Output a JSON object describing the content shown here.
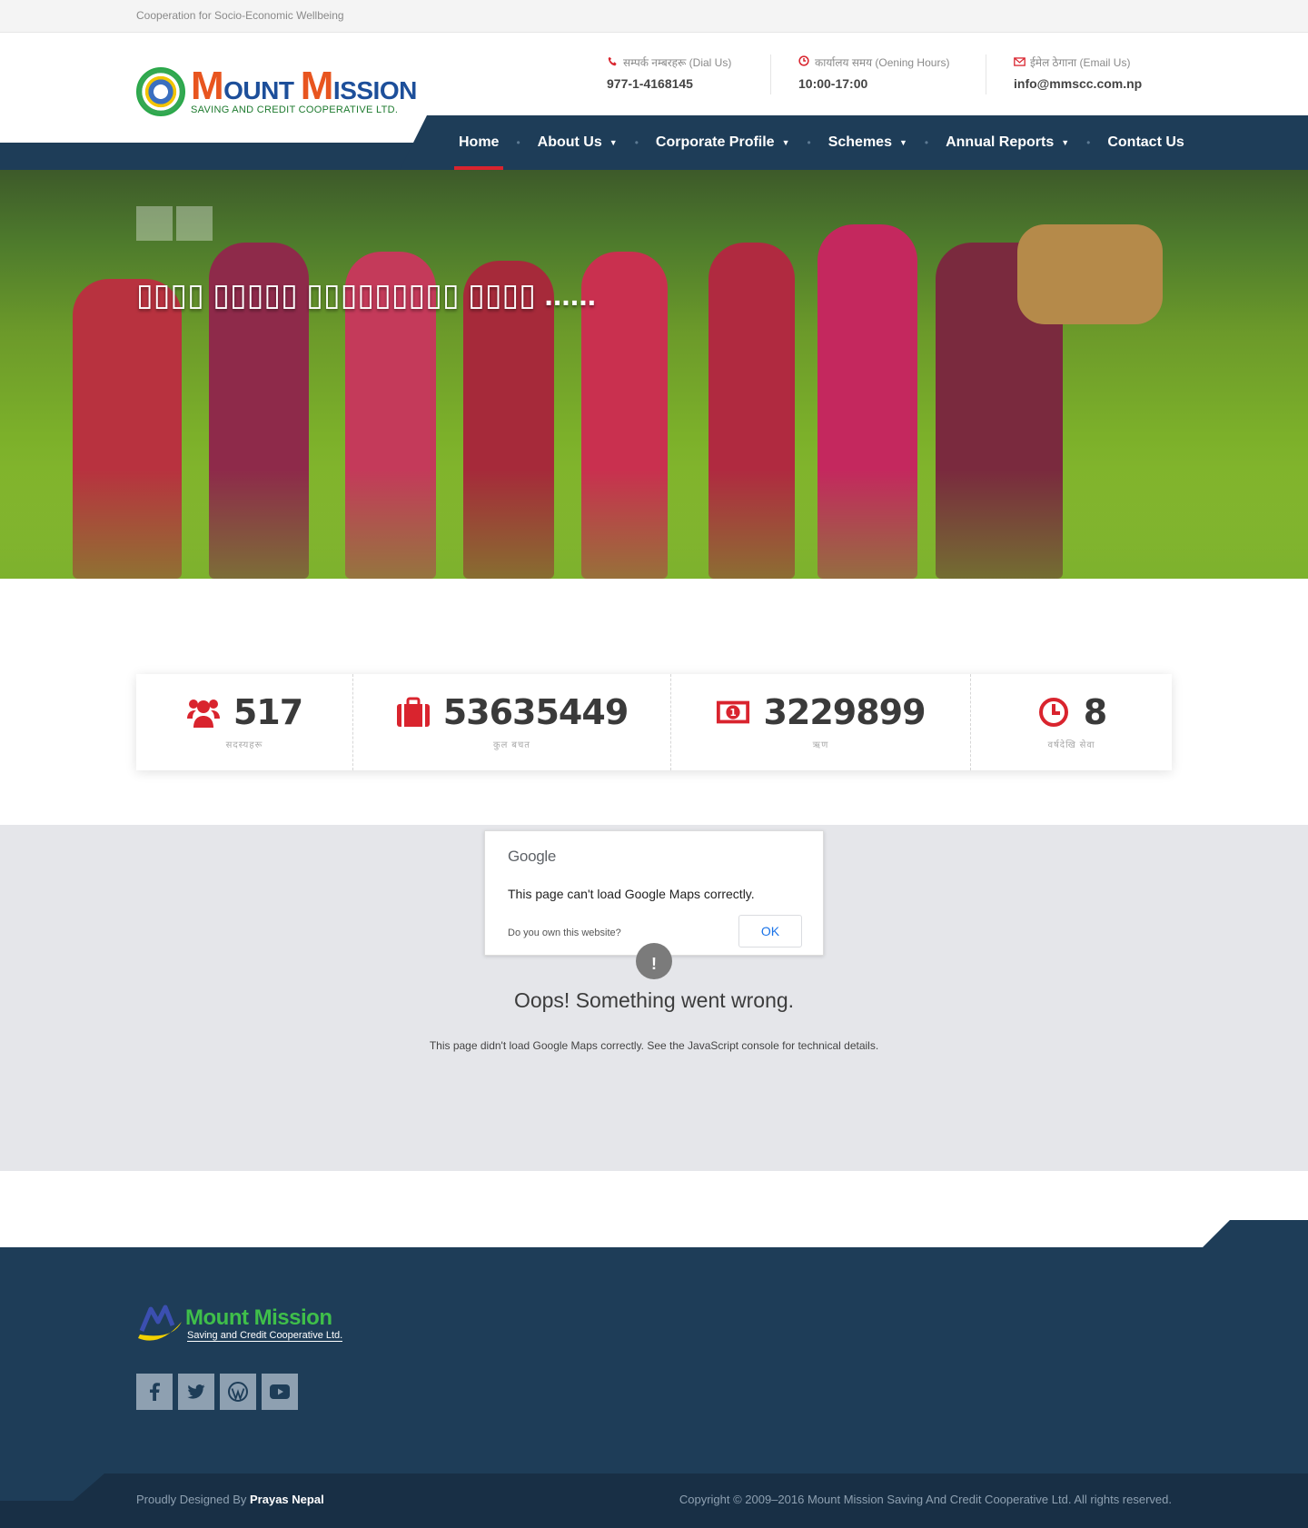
{
  "topbar": {
    "tagline": "Cooperation for Socio-Economic Wellbeing"
  },
  "logo": {
    "brand_m1": "M",
    "brand_1": "OUNT ",
    "brand_m2": "M",
    "brand_2": "ISSION",
    "subtitle": "SAVING AND CREDIT COOPERATIVE LTD."
  },
  "contacts": [
    {
      "icon": "phone-icon",
      "label": "सम्पर्क नम्बरहरू (Dial Us)",
      "value": "977-1-4168145"
    },
    {
      "icon": "clock-icon",
      "label": "कार्यालय समय (Oening Hours)",
      "value": "10:00-17:00"
    },
    {
      "icon": "envelope-icon",
      "label": "ईमेल ठेगाना (Email Us)",
      "value": "info@mmscc.com.np"
    }
  ],
  "nav": [
    {
      "label": "Home",
      "active": true,
      "dropdown": false
    },
    {
      "label": "About Us",
      "active": false,
      "dropdown": true
    },
    {
      "label": "Corporate Profile",
      "active": false,
      "dropdown": true
    },
    {
      "label": "Schemes",
      "active": false,
      "dropdown": true
    },
    {
      "label": "Annual Reports",
      "active": false,
      "dropdown": true
    },
    {
      "label": "Contact Us",
      "active": false,
      "dropdown": false
    }
  ],
  "hero": {
    "title": "▯▯▯▯ ▯▯▯▯▯ ▯▯▯▯▯▯▯▯▯ ▯▯▯▯ ......"
  },
  "stats": [
    {
      "icon": "users-icon",
      "value": "517",
      "label": "सदस्यहरू"
    },
    {
      "icon": "briefcase-icon",
      "value": "53635449",
      "label": "कुल बचत"
    },
    {
      "icon": "money-icon",
      "value": "3229899",
      "label": "ऋण"
    },
    {
      "icon": "clock-icon",
      "value": "8",
      "label": "वर्षदेखि सेवा"
    }
  ],
  "map": {
    "google_label": "Google",
    "dialog_message": "This page can't load Google Maps correctly.",
    "own_link": "Do you own this website?",
    "ok_label": "OK",
    "oops_title": "Oops! Something went wrong.",
    "oops_detail": "This page didn't load Google Maps correctly. See the JavaScript console for technical details."
  },
  "footer": {
    "logo_title": "Mount Mission",
    "logo_sub": "Saving and Credit Cooperative Ltd.",
    "social": [
      "facebook-icon",
      "twitter-icon",
      "wordpress-icon",
      "youtube-icon"
    ],
    "designed_prefix": "Proudly Designed By ",
    "designer": "Prayas Nepal",
    "copyright": "Copyright © 2009–2016 Mount Mission Saving And Credit Cooperative Ltd. All rights reserved."
  },
  "colors": {
    "navy": "#1e3d58",
    "accent_red": "#d9242e",
    "logo_orange": "#e8551f",
    "logo_green": "#3fbf4a"
  }
}
